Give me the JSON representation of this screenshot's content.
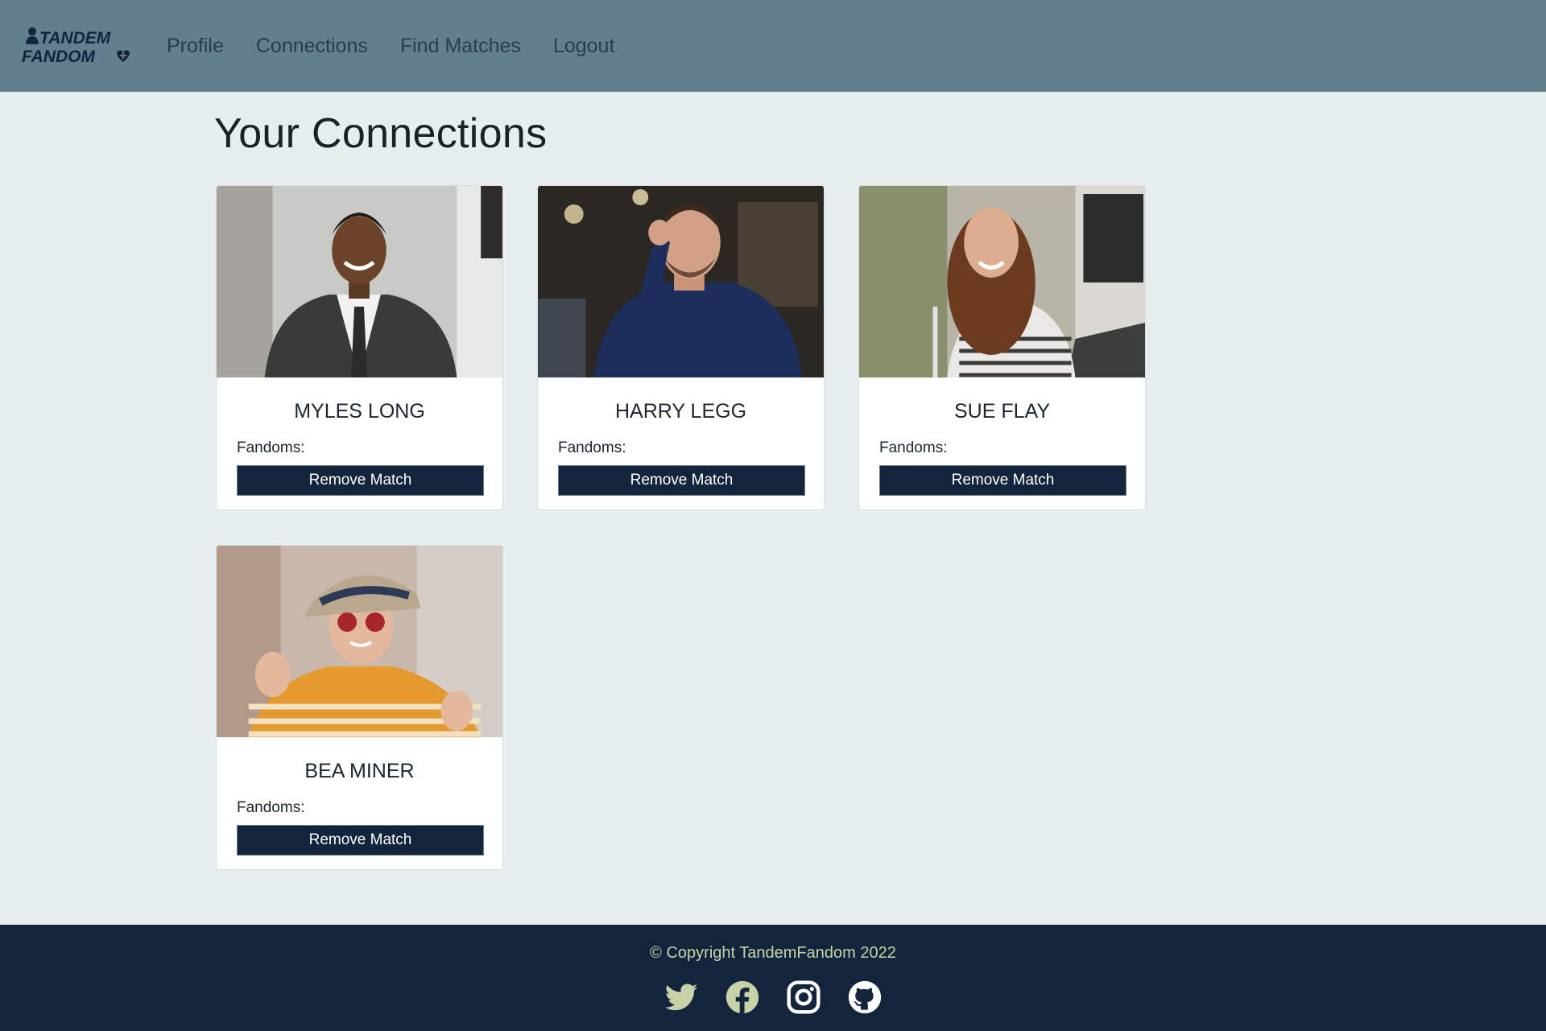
{
  "brand": {
    "line1": "TANDEM",
    "line2": "FANDOM",
    "colors": {
      "nav_bg": "#637f8e",
      "logo": "#13253d"
    }
  },
  "nav": {
    "items": [
      {
        "label": "Profile"
      },
      {
        "label": "Connections"
      },
      {
        "label": "Find Matches"
      },
      {
        "label": "Logout"
      }
    ]
  },
  "main": {
    "title": "Your Connections",
    "cards": [
      {
        "name": "MYLES LONG",
        "fandoms_label": "Fandoms:",
        "button_label": "Remove Match"
      },
      {
        "name": "HARRY LEGG",
        "fandoms_label": "Fandoms:",
        "button_label": "Remove Match"
      },
      {
        "name": "SUE FLAY",
        "fandoms_label": "Fandoms:",
        "button_label": "Remove Match"
      },
      {
        "name": "BEA MINER",
        "fandoms_label": "Fandoms:",
        "button_label": "Remove Match"
      }
    ]
  },
  "footer": {
    "copyright": "© Copyright TandemFandom 2022",
    "socials": [
      "twitter-icon",
      "facebook-icon",
      "instagram-icon",
      "github-icon"
    ],
    "icon_color": "#c7d3a6",
    "bg": "#13253d"
  },
  "button_color": "#13253d",
  "page_bg": "#e6efee"
}
